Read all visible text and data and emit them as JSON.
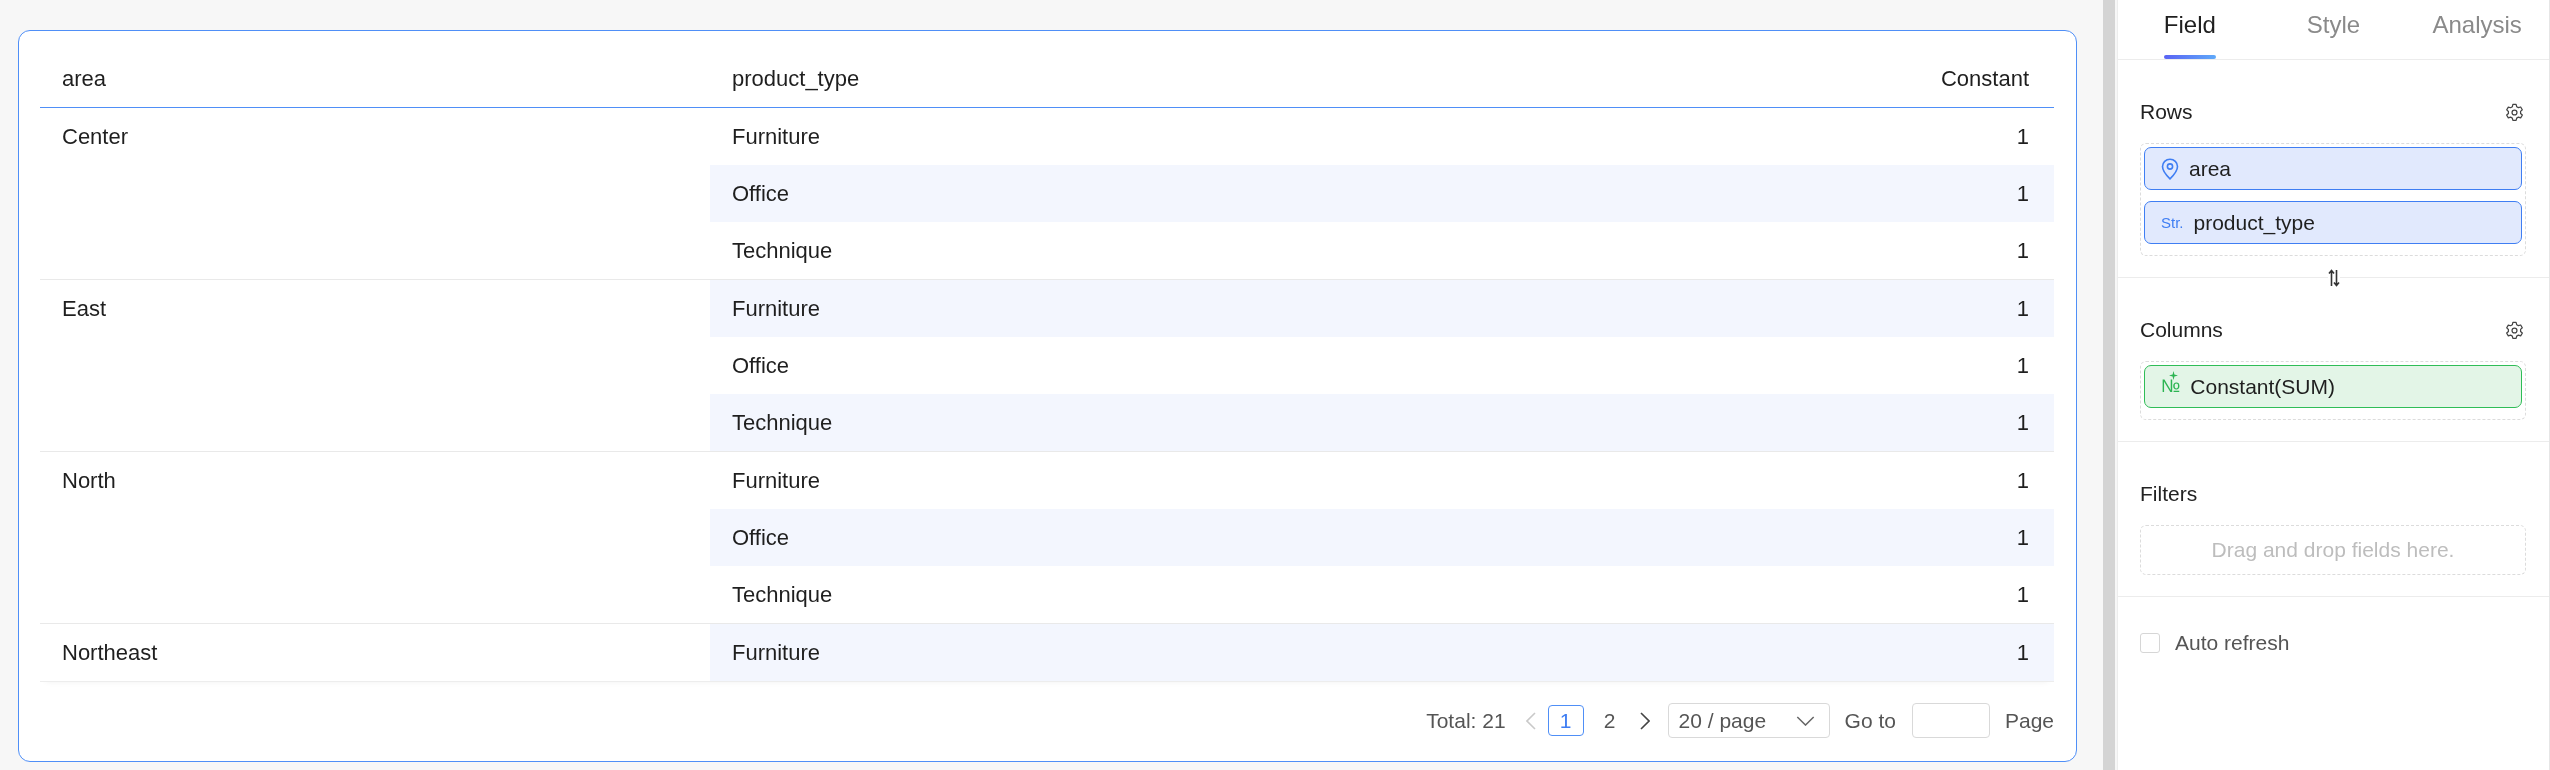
{
  "table": {
    "columns": [
      "area",
      "product_type",
      "Constant"
    ],
    "groups": [
      {
        "area": "Center",
        "rows": [
          {
            "product_type": "Furniture",
            "constant": "1"
          },
          {
            "product_type": "Office",
            "constant": "1"
          },
          {
            "product_type": "Technique",
            "constant": "1"
          }
        ]
      },
      {
        "area": "East",
        "rows": [
          {
            "product_type": "Furniture",
            "constant": "1"
          },
          {
            "product_type": "Office",
            "constant": "1"
          },
          {
            "product_type": "Technique",
            "constant": "1"
          }
        ]
      },
      {
        "area": "North",
        "rows": [
          {
            "product_type": "Furniture",
            "constant": "1"
          },
          {
            "product_type": "Office",
            "constant": "1"
          },
          {
            "product_type": "Technique",
            "constant": "1"
          }
        ]
      },
      {
        "area": "Northeast",
        "rows": [
          {
            "product_type": "Furniture",
            "constant": "1"
          }
        ]
      }
    ]
  },
  "pagination": {
    "total": "Total: 21",
    "previous": {
      "disabled": true
    },
    "pages": [
      {
        "label": "1",
        "selected": true
      },
      {
        "label": "2",
        "selected": false
      }
    ],
    "next": {
      "disabled": false
    },
    "page_size": "20 / page",
    "goto_label": "Go to",
    "page_label": "Page"
  },
  "panel": {
    "tabs": [
      {
        "label": "Field",
        "selected": true
      },
      {
        "label": "Style",
        "selected": false
      },
      {
        "label": "Analysis",
        "selected": false
      }
    ],
    "sections": [
      {
        "title": "Rows",
        "settings": true,
        "fields": [
          {
            "kind": "geo",
            "name": "area"
          },
          {
            "kind": "string",
            "type_label": "Str.",
            "name": "product_type"
          }
        ]
      },
      {
        "title": "Columns",
        "settings": true,
        "fields": [
          {
            "kind": "number",
            "type_label": "№",
            "name": "Constant(SUM)"
          }
        ]
      },
      {
        "title": "Filters",
        "settings": false,
        "empty_text": "Drag and drop fields here."
      }
    ],
    "auto_refresh": {
      "label": "Auto refresh",
      "checked": false
    }
  }
}
